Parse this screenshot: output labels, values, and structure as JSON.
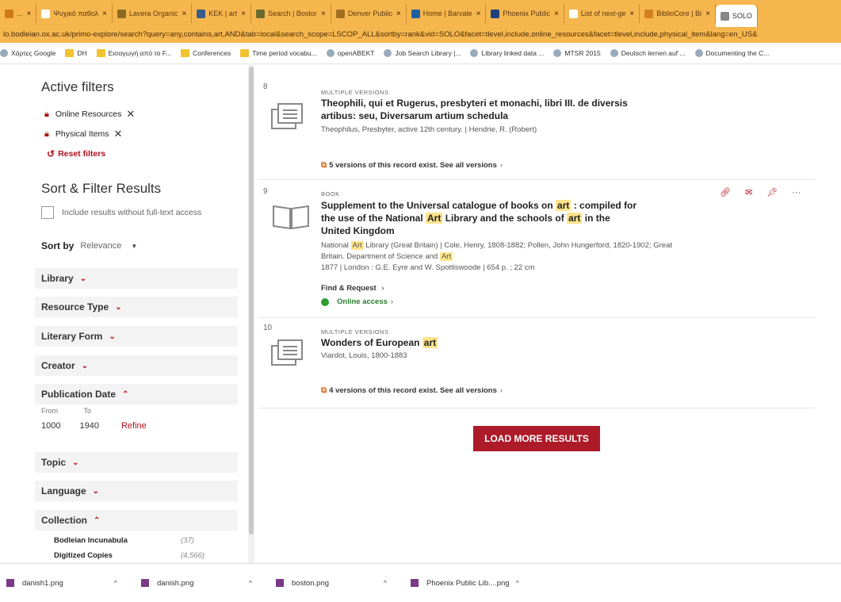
{
  "browser": {
    "tabs": [
      {
        "label": "...",
        "icon": "tab-icon",
        "color": "#d07a1a"
      },
      {
        "label": "Ψυχικό παθολ",
        "icon": "doc-icon",
        "color": "#ffffff"
      },
      {
        "label": "Lavera Organic",
        "icon": "leaf-icon",
        "color": "#8a6a20"
      },
      {
        "label": "ΚΕΚ | art",
        "icon": "bars-icon",
        "color": "#3a5a8a"
      },
      {
        "label": "Search | Boston",
        "icon": "building-icon",
        "color": "#6a6a30"
      },
      {
        "label": "Denver Public",
        "icon": "star-icon",
        "color": "#a07020"
      },
      {
        "label": "Home | Barvale",
        "icon": "grid-icon",
        "color": "#2060a0"
      },
      {
        "label": "Phoenix Public",
        "icon": "phoenix-icon",
        "color": "#204080"
      },
      {
        "label": "List of next-ge",
        "icon": "wikipedia-icon",
        "color": "#ffffff"
      },
      {
        "label": "BiblioCore | Bi",
        "icon": "people-icon",
        "color": "#d08020"
      },
      {
        "label": "SOLO",
        "icon": "s-icon",
        "color": "#888888"
      }
    ],
    "url": "lo.bodleian.ox.ac.uk/primo-explore/search?query=any,contains,art,AND&tab=local&search_scope=LSCOP_ALL&sortby=rank&vid=SOLO&facet=tlevel,include,online_resources&facet=tlevel,include,physical_item&lang=en_US&",
    "bookmarks": [
      {
        "label": "Χάρτες Google",
        "icon": "google-icon"
      },
      {
        "label": "DH",
        "icon": "folder-icon"
      },
      {
        "label": "Εισαγωγή από το F...",
        "icon": "folder-icon"
      },
      {
        "label": "Conferences",
        "icon": "folder-icon"
      },
      {
        "label": "Time period vocabu...",
        "icon": "folder-icon"
      },
      {
        "label": "openABEKT",
        "icon": "bookmark-icon"
      },
      {
        "label": "Job Search Library |...",
        "icon": "grid-icon"
      },
      {
        "label": "Library linked data ...",
        "icon": "grid-icon"
      },
      {
        "label": "MTSR 2015",
        "icon": "globe-icon"
      },
      {
        "label": "Deutsch lernen auf ...",
        "icon": "dw-icon"
      },
      {
        "label": "Documenting the C...",
        "icon": "doc-icon"
      }
    ]
  },
  "filters": {
    "active_title": "Active filters",
    "chips": [
      {
        "label": "Online Resources"
      },
      {
        "label": "Physical Items"
      }
    ],
    "reset_label": "Reset filters"
  },
  "sort_filter": {
    "title": "Sort & Filter Results",
    "checkbox_label": "Include results without full-text access",
    "sort_by_label": "Sort by",
    "sort_by_value": "Relevance",
    "facets": [
      {
        "label": "Library",
        "expanded": false
      },
      {
        "label": "Resource Type",
        "expanded": false
      },
      {
        "label": "Literary Form",
        "expanded": false
      },
      {
        "label": "Creator",
        "expanded": false
      },
      {
        "label": "Publication Date",
        "expanded": true
      },
      {
        "label": "Topic",
        "expanded": false
      },
      {
        "label": "Language",
        "expanded": false
      },
      {
        "label": "Collection",
        "expanded": true
      }
    ],
    "date": {
      "from_label": "From",
      "to_label": "To",
      "from": "1000",
      "to": "1940",
      "refine": "Refine"
    },
    "collections": [
      {
        "name": "Bodleian Incunabula",
        "count": "(37)"
      },
      {
        "name": "Digitized Copies",
        "count": "(4,566)"
      }
    ]
  },
  "results": [
    {
      "number": "8",
      "type": "MULTIPLE VERSIONS",
      "title_line1": "Theophili, qui et Rugerus, presbyteri et monachi, libri III. de diversis",
      "title_line2": "artibus: seu, Diversarum artium schedula",
      "authors": "Theophilus, Presbyter, active 12th century. | Hendrie, R. (Robert)",
      "versions": "5 versions of this record exist. See all versions"
    },
    {
      "number": "9",
      "type": "BOOK",
      "title_a": "Supplement to the Universal catalogue of books on ",
      "title_hl1": "art",
      "title_b": " : compiled for",
      "title_c": "the use of the National ",
      "title_hl2": "Art",
      "title_d": " Library and the schools of ",
      "title_hl3": "art",
      "title_e": " in the",
      "title_f": "United Kingdom",
      "authors_a": "National ",
      "authors_hl": "Art",
      "authors_b": " Library (Great Britain) | Cole, Henry, 1808-1882; Pollen, John Hungerford, 1820-1902; Great",
      "authors_c": "Britain. Department of Science and ",
      "authors_hl2": "Art",
      "pub": "1877 | London : G.E. Eyre and W. Spottiswoode | 654 p. ; 22 cm",
      "find": "Find & Request",
      "online": "Online access"
    },
    {
      "number": "10",
      "type": "MULTIPLE VERSIONS",
      "title_a": "Wonders of European ",
      "title_hl": "art",
      "authors": "Viardot, Louis, 1800-1883",
      "versions": "4 versions of this record exist. See all versions"
    }
  ],
  "load_more": "LOAD MORE RESULTS",
  "downloads": [
    {
      "name": "danish1.png"
    },
    {
      "name": "danish.png"
    },
    {
      "name": "boston.png"
    },
    {
      "name": "Phoenix Public Lib....png"
    }
  ]
}
